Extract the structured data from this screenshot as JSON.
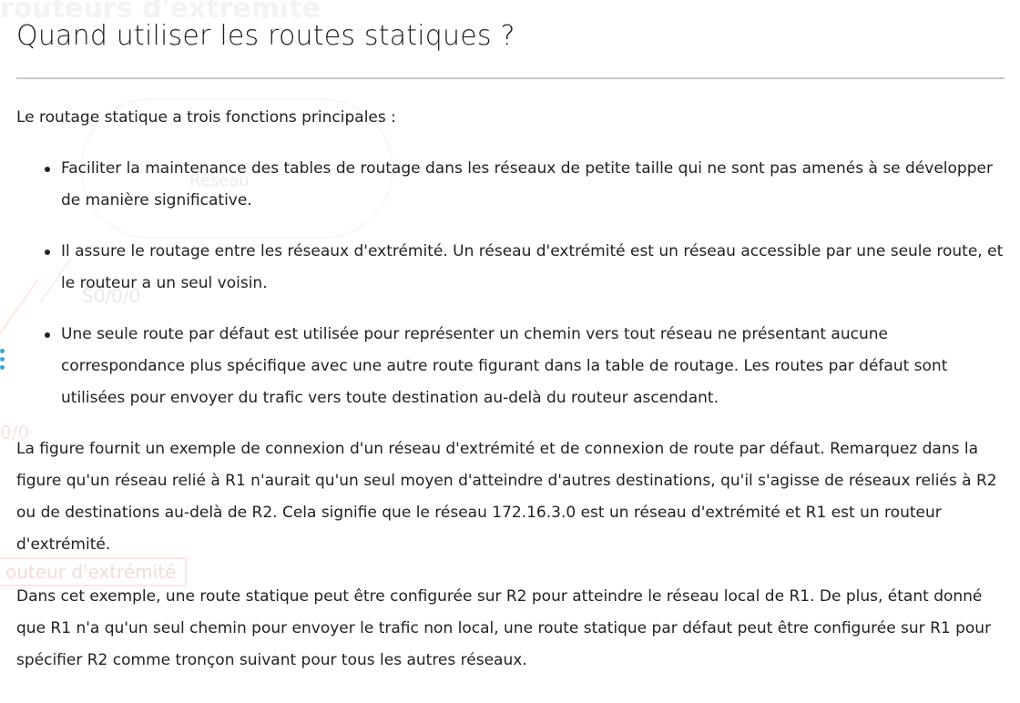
{
  "background_ghost": {
    "top_text": "routeurs d'extrémité",
    "cloud_label": "Réseau",
    "interface_label": "S0/0/0",
    "partial_interface": "0/0",
    "router_label": "outeur d'extrémité"
  },
  "page": {
    "title": "Quand utiliser les routes statiques ?",
    "intro": "Le routage statique a trois fonctions principales :",
    "bullets": [
      "Faciliter la maintenance des tables de routage dans les réseaux de petite taille qui ne sont pas amenés à se développer de manière significative.",
      "Il assure le routage entre les réseaux d'extrémité. Un réseau d'extrémité est un réseau accessible par une seule route, et le routeur a un seul voisin.",
      "Une seule route par défaut est utilisée pour représenter un chemin vers tout réseau ne présentant aucune correspondance plus spécifique avec une autre route figurant dans la table de routage. Les routes par défaut sont utilisées pour envoyer du trafic vers toute destination au-delà du routeur ascendant."
    ],
    "paragraph_figure": "La figure fournit un exemple de connexion d'un réseau d'extrémité et de connexion de route par défaut. Remarquez dans la figure qu'un réseau relié à R1 n'aurait qu'un seul moyen d'atteindre d'autres destinations, qu'il s'agisse de réseaux reliés à R2 ou de destinations au-delà de R2. Cela signifie que le réseau 172.16.3.0 est un réseau d'extrémité et R1 est un routeur d'extrémité.",
    "paragraph_example": "Dans cet exemple, une route statique peut être configurée sur R2 pour atteindre le réseau local de R1. De plus, étant donné que R1 n'a qu'un seul chemin pour envoyer le trafic non local, une route statique par défaut peut être configurée sur R1 pour spécifier R2 comme tronçon suivant pour tous les autres réseaux."
  },
  "colors": {
    "text": "#222222",
    "rule": "#c8c8c8",
    "background": "#ffffff"
  }
}
